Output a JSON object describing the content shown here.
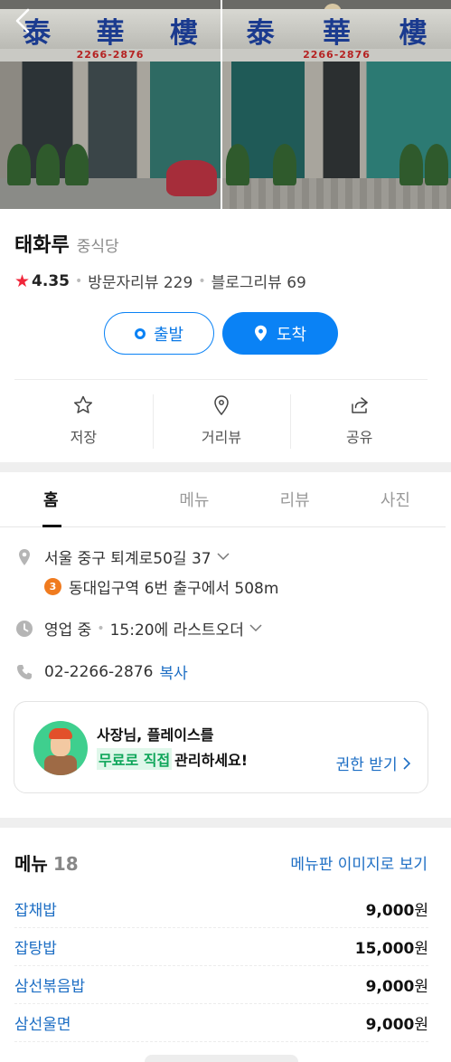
{
  "hero": {
    "photos": [
      {
        "sign_chars": [
          "泰",
          "華",
          "樓"
        ],
        "phone": "2266-2876"
      },
      {
        "sign_chars": [
          "泰",
          "華",
          "樓"
        ],
        "phone": "2266-2876"
      }
    ]
  },
  "place": {
    "name": "태화루",
    "category": "중식당",
    "rating": "4.35",
    "visitor_reviews": "방문자리뷰 229",
    "blog_reviews": "블로그리뷰 69"
  },
  "route": {
    "start_label": "출발",
    "arrive_label": "도착"
  },
  "actions": [
    {
      "label": "저장",
      "icon": "star-icon"
    },
    {
      "label": "거리뷰",
      "icon": "map-pin-icon"
    },
    {
      "label": "공유",
      "icon": "share-icon"
    }
  ],
  "tabs": [
    {
      "label": "홈",
      "active": true
    },
    {
      "label": "메뉴",
      "active": false
    },
    {
      "label": "리뷰",
      "active": false
    },
    {
      "label": "사진",
      "active": false
    }
  ],
  "info": {
    "address": "서울 중구 퇴계로50길 37",
    "metro_line": "3",
    "directions": "동대입구역 6번 출구에서 508m",
    "hours": "영업 중",
    "last_order": "15:20에 라스트오더",
    "phone": "02-2266-2876",
    "copy_label": "복사"
  },
  "owner_card": {
    "line1": "사장님, 플레이스를",
    "highlight": "무료로 직접",
    "line2_rest": "관리하세요!",
    "claim_label": "권한 받기"
  },
  "menu": {
    "title": "메뉴",
    "count": "18",
    "image_link": "메뉴판 이미지로 보기",
    "currency": "원",
    "items": [
      {
        "name": "잡채밥",
        "price": "9,000"
      },
      {
        "name": "잡탕밥",
        "price": "15,000"
      },
      {
        "name": "삼선볶음밥",
        "price": "9,000"
      },
      {
        "name": "삼선울면",
        "price": "9,000"
      }
    ]
  },
  "colors": {
    "accent": "#0a82f5",
    "link": "#1d6ec4",
    "rating_star": "#f0263a",
    "metro_line_3": "#f07b1f",
    "highlight_green": "#0fa65a"
  }
}
